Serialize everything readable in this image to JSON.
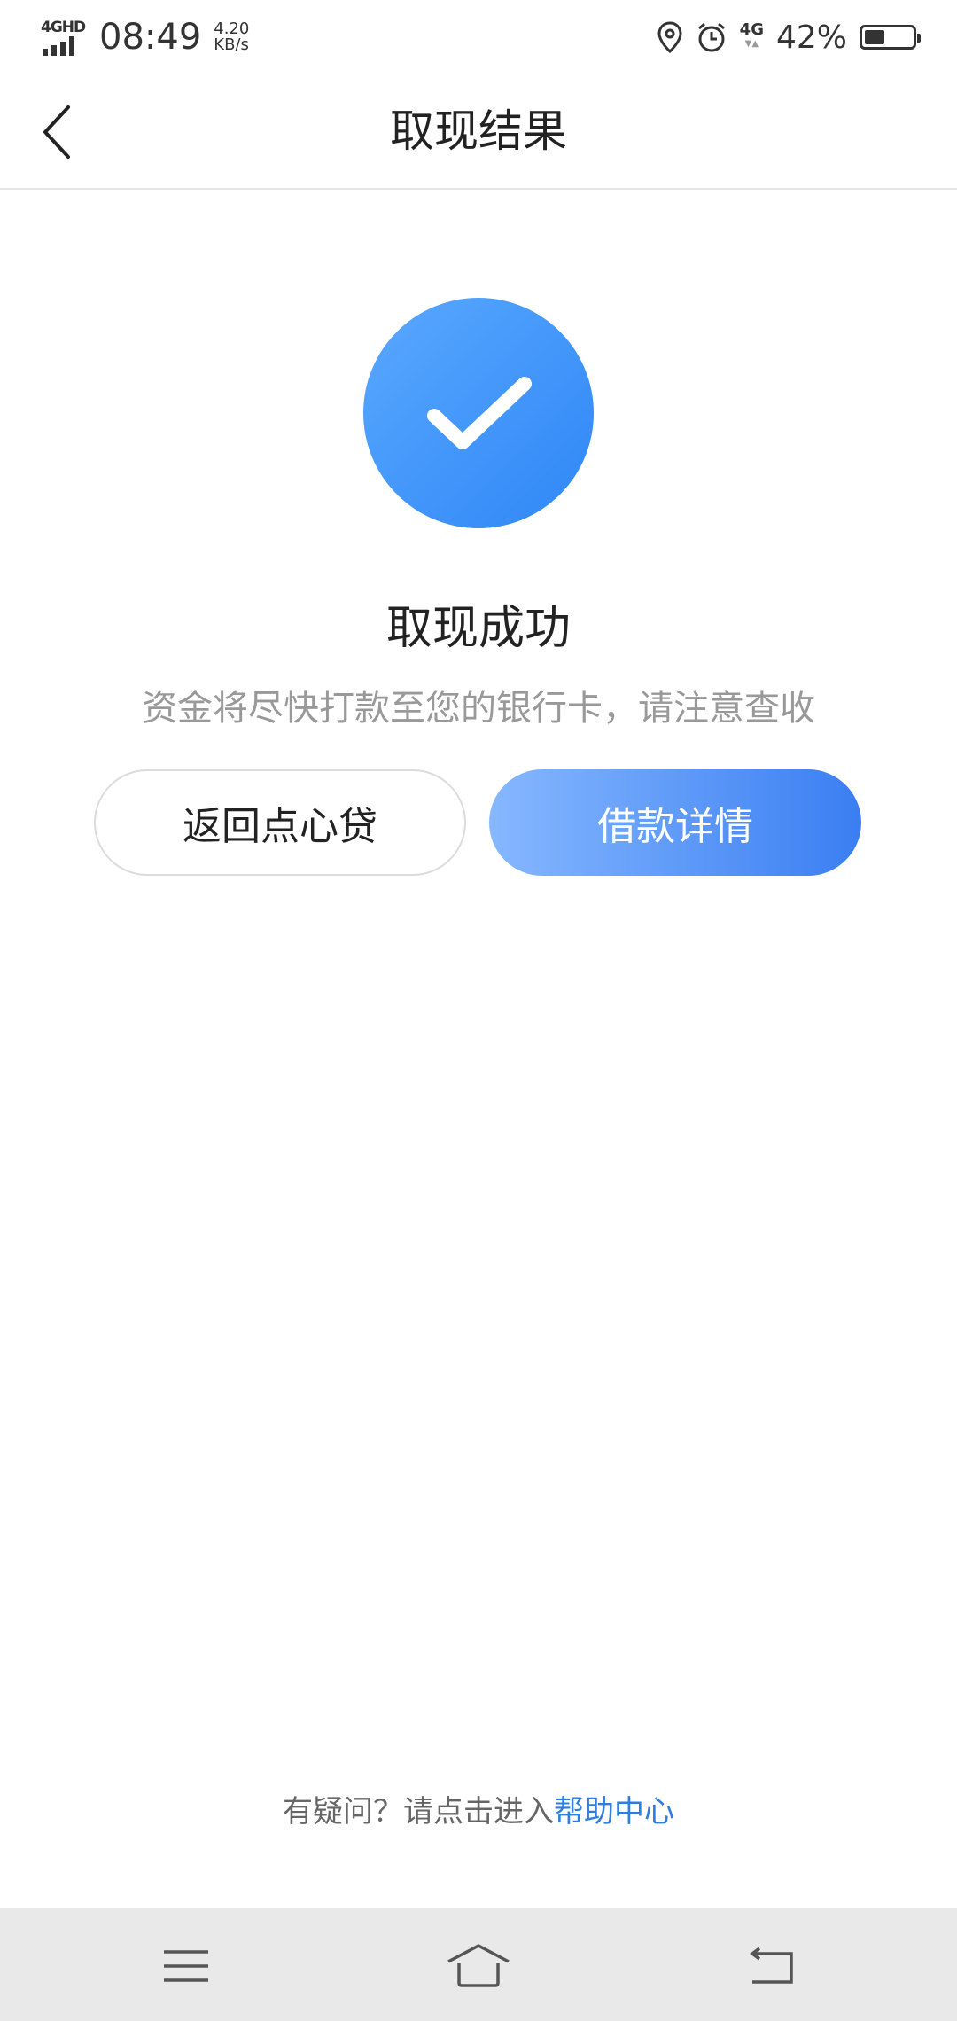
{
  "status_bar": {
    "network_label": "4GHD",
    "time": "08:49",
    "speed_value": "4.20",
    "speed_unit": "KB/s",
    "network_type": "4G",
    "battery_percent": "42%",
    "battery_level": 0.42,
    "icons": [
      "signal-icon",
      "location-icon",
      "alarm-icon",
      "battery-icon"
    ]
  },
  "header": {
    "back_icon": "chevron-left-icon",
    "title": "取现结果"
  },
  "result": {
    "icon": "check-circle-icon",
    "accent_color": "#2f86f6",
    "title": "取现成功",
    "description": "资金将尽快打款至您的银行卡，请注意查收"
  },
  "actions": {
    "back_label": "返回点心贷",
    "detail_label": "借款详情"
  },
  "help": {
    "prefix": "有疑问？请点击进入",
    "link": "帮助中心",
    "link_color": "#2f7de1"
  },
  "system_nav": {
    "icons": [
      "menu-icon",
      "home-icon",
      "back-icon"
    ]
  }
}
